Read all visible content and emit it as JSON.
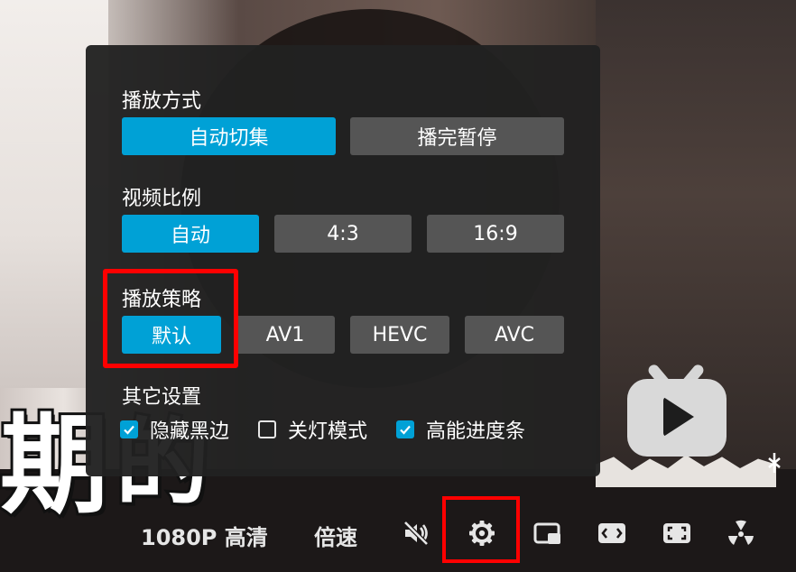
{
  "panel": {
    "play_mode": {
      "title": "播放方式",
      "options": [
        "自动切集",
        "播完暂停"
      ],
      "selected": 0
    },
    "aspect_ratio": {
      "title": "视频比例",
      "options": [
        "自动",
        "4:3",
        "16:9"
      ],
      "selected": 0
    },
    "play_strategy": {
      "title": "播放策略",
      "options": [
        "默认",
        "AV1",
        "HEVC",
        "AVC"
      ],
      "selected": 0
    },
    "other_settings": {
      "title": "其它设置",
      "items": [
        {
          "label": "隐藏黑边",
          "checked": true
        },
        {
          "label": "关灯模式",
          "checked": false
        },
        {
          "label": "高能进度条",
          "checked": true
        }
      ]
    }
  },
  "controls": {
    "quality": "1080P 高清",
    "speed": "倍速",
    "icons": [
      "mute-icon",
      "gear-icon",
      "pip-icon",
      "widescreen-icon",
      "fullscreen-icon",
      "radiation-icon"
    ]
  },
  "video": {
    "overlay_text_1": "期",
    "overlay_text_2": "的"
  },
  "colors": {
    "accent": "#00a1d6",
    "button": "#555555",
    "panel": "#212121",
    "highlight": "#ff0000"
  }
}
